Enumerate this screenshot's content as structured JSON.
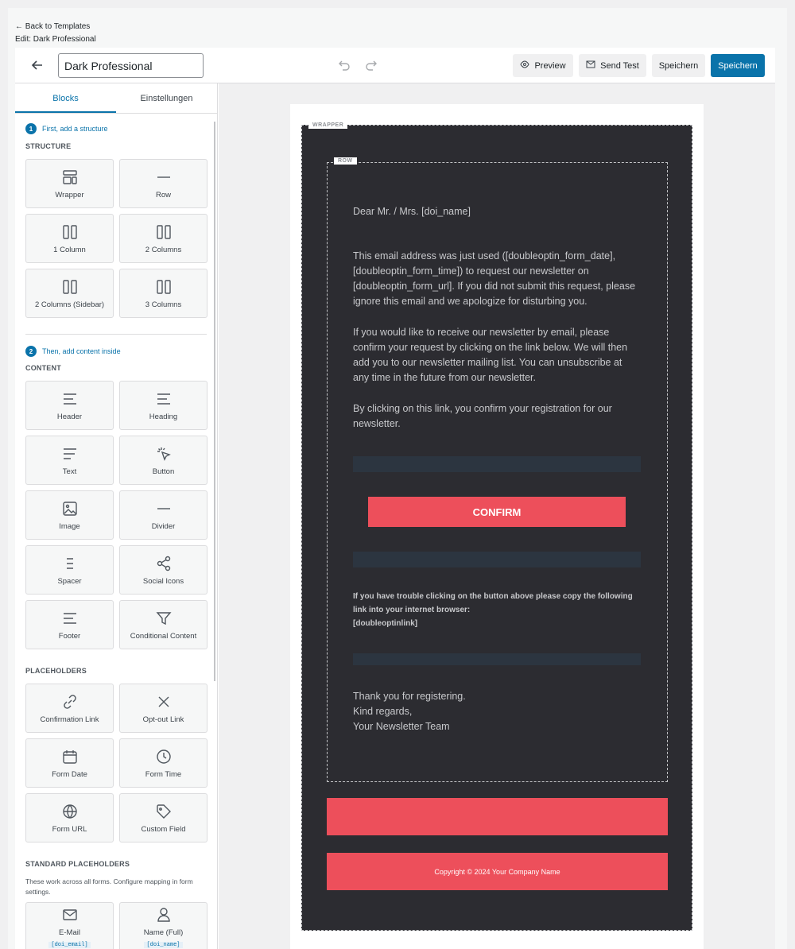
{
  "top_links": {
    "back": "← Back to Templates",
    "edit": "Edit: Dark Professional"
  },
  "toolbar": {
    "template_name": "Dark Professional",
    "preview": "Preview",
    "send_test": "Send Test",
    "save_secondary": "Speichern",
    "save_primary": "Speichern"
  },
  "sidebar": {
    "tabs": [
      "Blocks",
      "Einstellungen"
    ],
    "step1": {
      "num": "1",
      "text": "First, add a structure"
    },
    "structure_label": "STRUCTURE",
    "structure": [
      {
        "label": "Wrapper",
        "icon": "wrapper-icon"
      },
      {
        "label": "Row",
        "icon": "row-icon"
      },
      {
        "label": "1 Column",
        "icon": "columns-icon"
      },
      {
        "label": "2 Columns",
        "icon": "columns-icon"
      },
      {
        "label": "2 Columns (Sidebar)",
        "icon": "columns-icon"
      },
      {
        "label": "3 Columns",
        "icon": "columns-icon"
      }
    ],
    "step2": {
      "num": "2",
      "text": "Then, add content inside"
    },
    "content_label": "CONTENT",
    "content": [
      {
        "label": "Header",
        "icon": "header-icon"
      },
      {
        "label": "Heading",
        "icon": "heading-icon"
      },
      {
        "label": "Text",
        "icon": "text-icon"
      },
      {
        "label": "Button",
        "icon": "click-icon"
      },
      {
        "label": "Image",
        "icon": "image-icon"
      },
      {
        "label": "Divider",
        "icon": "divider-icon"
      },
      {
        "label": "Spacer",
        "icon": "spacer-icon"
      },
      {
        "label": "Social Icons",
        "icon": "share-icon"
      },
      {
        "label": "Footer",
        "icon": "footer-icon"
      },
      {
        "label": "Conditional Content",
        "icon": "filter-icon"
      }
    ],
    "placeholders_label": "PLACEHOLDERS",
    "placeholders": [
      {
        "label": "Confirmation Link",
        "icon": "link-icon"
      },
      {
        "label": "Opt-out Link",
        "icon": "x-icon"
      },
      {
        "label": "Form Date",
        "icon": "calendar-icon"
      },
      {
        "label": "Form Time",
        "icon": "clock-icon"
      },
      {
        "label": "Form URL",
        "icon": "globe-icon"
      },
      {
        "label": "Custom Field",
        "icon": "tag-icon"
      }
    ],
    "standard_label": "STANDARD PLACEHOLDERS",
    "standard_note": "These work across all forms. Configure mapping in form settings.",
    "standard": [
      {
        "label": "E-Mail",
        "code": "[doi_email]",
        "icon": "mail-icon"
      },
      {
        "label": "Name (Full)",
        "code": "[doi_name]",
        "icon": "user-icon"
      }
    ]
  },
  "email": {
    "wrapper_tag": "WRAPPER",
    "row_tag": "ROW",
    "greeting": "Dear Mr. / Mrs. [doi_name]",
    "para1": "This email address was just used ([doubleoptin_form_date], [doubleoptin_form_time]) to request our newsletter on [doubleoptin_form_url]. If you did not submit this request, please ignore this email and we apologize for disturbing you.",
    "para2": "If you would like to receive our newsletter by email, please confirm your request by clicking on the link below. We will then add you to our newsletter mailing list. You can unsubscribe at any time in the future from our newsletter.",
    "para3": "By clicking on this link, you confirm your registration for our newsletter.",
    "confirm_button": "CONFIRM",
    "trouble_text": "If you have trouble clicking on the button above please copy the following link into your internet browser:",
    "link_placeholder": "[doubleoptinlink]",
    "thanks": "Thank you for registering.",
    "regards": "Kind regards,",
    "team": "Your Newsletter Team",
    "footer_copyright": "Copyright © 2024 Your Company Name"
  },
  "colors": {
    "accent": "#0a73aa",
    "email_bg": "#2c2c31",
    "email_red": "#ed4f5b"
  }
}
